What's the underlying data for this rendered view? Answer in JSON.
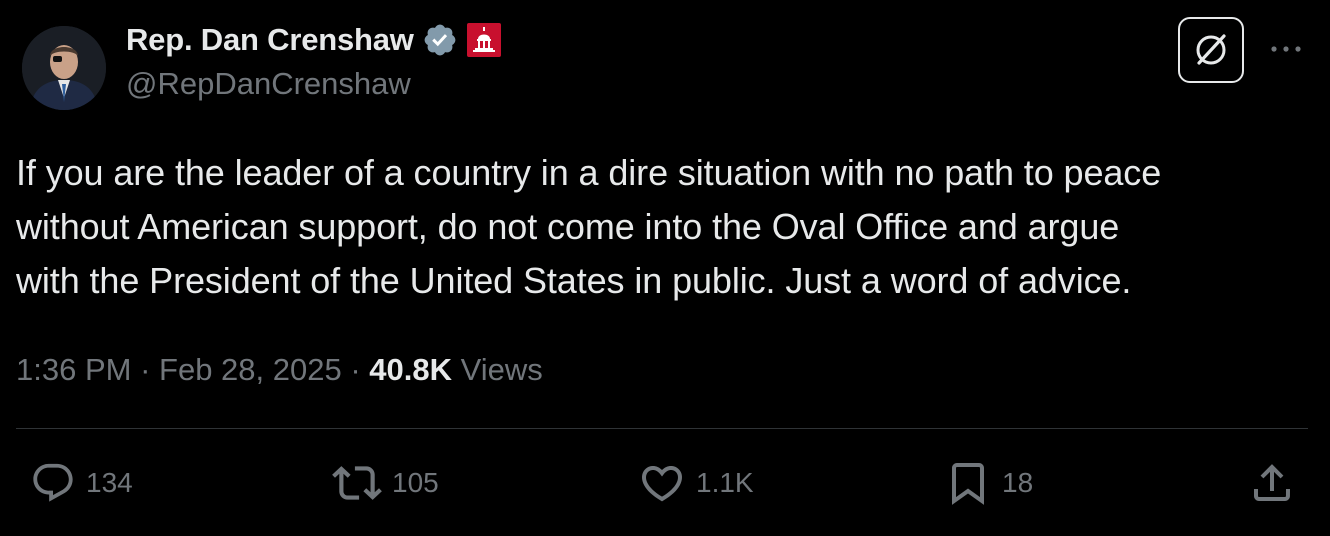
{
  "author": {
    "display_name": "Rep. Dan Crenshaw",
    "handle": "@RepDanCrenshaw",
    "verified_icon": "verified-badge-icon",
    "affiliation_icon": "us-capitol-icon"
  },
  "tweet": {
    "text": "If you are the leader of a country in a dire situation with no path to peace\nwithout American support, do not come into the Oval Office and argue\nwith the President of the United States in public. Just a word of advice."
  },
  "meta": {
    "time": "1:36 PM",
    "separator": " · ",
    "date": "Feb 28, 2025",
    "views_count": "40.8K",
    "views_label": " Views"
  },
  "actions": {
    "replies": "134",
    "reposts": "105",
    "likes": "1.1K",
    "bookmarks": "18"
  },
  "colors": {
    "background": "#000000",
    "text_primary": "#e7e9ea",
    "text_secondary": "#71767b",
    "divider": "#2f3336",
    "badge_gray": "#829aab",
    "affiliation_red": "#c8102e"
  }
}
